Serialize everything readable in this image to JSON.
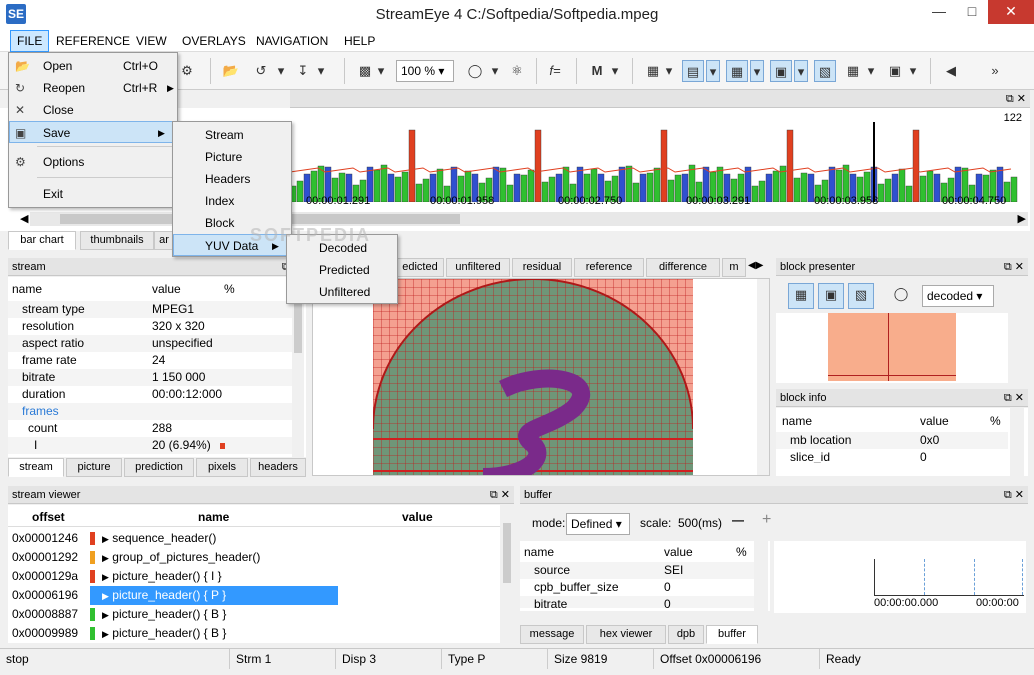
{
  "window": {
    "title": "StreamEye 4 C:/Softpedia/Softpedia.mpeg",
    "app_icon": "SE"
  },
  "menubar": [
    "FILE",
    "REFERENCE",
    "VIEW",
    "OVERLAYS",
    "NAVIGATION",
    "HELP"
  ],
  "toolbar": {
    "zoom": "100 %"
  },
  "file_menu": [
    {
      "label": "Open",
      "shortcut": "Ctrl+O",
      "icon": "folder-open-icon"
    },
    {
      "label": "Reopen",
      "shortcut": "Ctrl+R",
      "icon": "reopen-icon"
    },
    {
      "label": "Close",
      "shortcut": "",
      "icon": "close-icon"
    },
    {
      "label": "Save",
      "shortcut": "",
      "icon": "save-icon"
    },
    {
      "label": "Options",
      "shortcut": "",
      "icon": "gear-icon"
    },
    {
      "label": "Exit",
      "shortcut": "",
      "icon": ""
    }
  ],
  "save_menu": [
    "Stream",
    "Picture",
    "Headers",
    "Index",
    "Block",
    "YUV Data"
  ],
  "yuv_menu": [
    "Decoded",
    "Predicted",
    "Unfiltered"
  ],
  "timeline": {
    "max_label": "122",
    "time_labels": [
      "00:00:01.291",
      "00:00:01.958",
      "00:00:02.750",
      "00:00:03.291",
      "00:00:03.958",
      "00:00:04.750"
    ],
    "tabs": [
      "bar chart",
      "thumbnails",
      "ar"
    ]
  },
  "stream_panel": {
    "title": "stream",
    "columns": [
      "name",
      "value",
      "%"
    ],
    "rows": [
      {
        "name": "stream type",
        "value": "MPEG1"
      },
      {
        "name": "resolution",
        "value": "320 x 320"
      },
      {
        "name": "aspect ratio",
        "value": "unspecified"
      },
      {
        "name": "frame rate",
        "value": "24"
      },
      {
        "name": "bitrate",
        "value": "1 150 000"
      },
      {
        "name": "duration",
        "value": "00:00:12:000"
      },
      {
        "name": "frames",
        "value": ""
      },
      {
        "name": "count",
        "value": "288"
      },
      {
        "name": "I",
        "value": "20 (6.94%)"
      }
    ],
    "tabs": [
      "stream",
      "picture",
      "prediction",
      "pixels",
      "headers"
    ]
  },
  "view_tabs": [
    "edicted",
    "unfiltered",
    "residual",
    "reference",
    "difference",
    "m"
  ],
  "block_presenter": {
    "title": "block presenter",
    "mode": "decoded"
  },
  "block_info": {
    "title": "block info",
    "columns": [
      "name",
      "value",
      "%"
    ],
    "rows": [
      {
        "name": "mb location",
        "value": "0x0"
      },
      {
        "name": "slice_id",
        "value": "0"
      }
    ]
  },
  "stream_viewer": {
    "title": "stream viewer",
    "columns": [
      "offset",
      "name",
      "value"
    ],
    "rows": [
      {
        "offset": "0x00001246",
        "name": "sequence_header()",
        "color": "#e04020"
      },
      {
        "offset": "0x00001292",
        "name": "group_of_pictures_header()",
        "color": "#f0a020"
      },
      {
        "offset": "0x0000129a",
        "name": "picture_header() { I }",
        "color": "#e04020"
      },
      {
        "offset": "0x00006196",
        "name": "picture_header() { P }",
        "color": "#2a9aff"
      },
      {
        "offset": "0x00008887",
        "name": "picture_header() { B }",
        "color": "#30c030"
      },
      {
        "offset": "0x00009989",
        "name": "picture_header() { B }",
        "color": "#30c030"
      }
    ]
  },
  "buffer": {
    "title": "buffer",
    "mode_label": "mode:",
    "mode": "Defined",
    "scale_label": "scale:",
    "scale": "500(ms)",
    "columns": [
      "name",
      "value",
      "%"
    ],
    "rows": [
      {
        "name": "source",
        "value": "SEI"
      },
      {
        "name": "cpb_buffer_size",
        "value": "0"
      },
      {
        "name": "bitrate",
        "value": "0"
      }
    ],
    "axis_labels": [
      "00:00:00.000",
      "00:00:00"
    ],
    "tabs": [
      "message",
      "hex viewer",
      "dpb",
      "buffer"
    ]
  },
  "statusbar": [
    "stop",
    "Strm 1",
    "Disp 3",
    "Type P",
    "Size 9819",
    "Offset 0x00006196",
    "Ready"
  ],
  "watermark": "SOFTPEDIA",
  "colors": {
    "accent": "#3399ff",
    "i_frame": "#e04020",
    "p_frame": "#3050d0",
    "b_frame": "#30c030"
  }
}
